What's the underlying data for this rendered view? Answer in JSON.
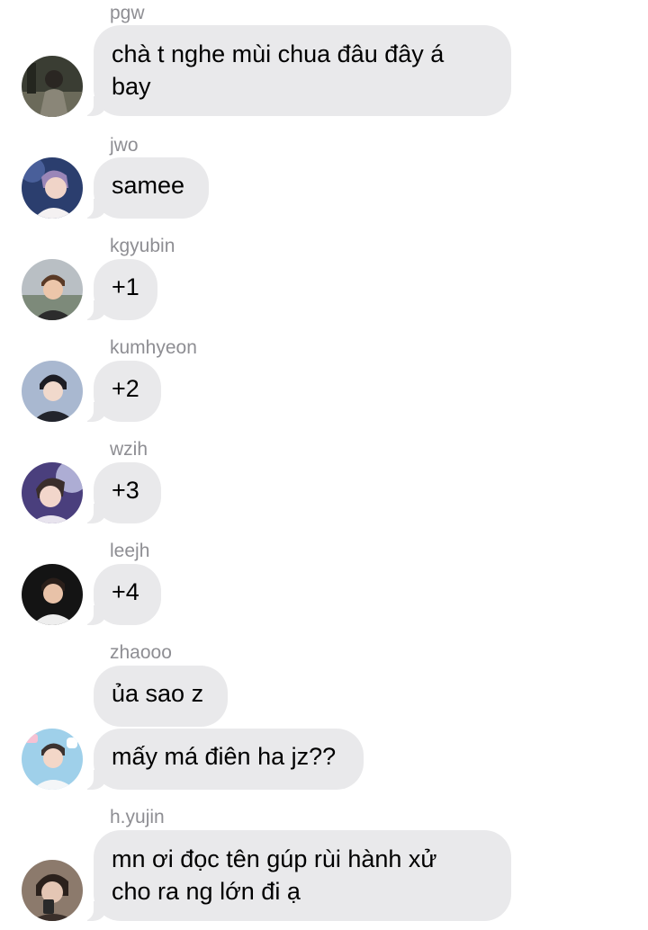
{
  "messages": [
    {
      "sender": "pgw",
      "lines": [
        "chà t nghe mùi chua đâu đây á",
        "bay"
      ],
      "avatar": "profile-photo-pgw"
    },
    {
      "sender": "jwo",
      "lines": [
        "samee"
      ],
      "avatar": "profile-photo-jwo"
    },
    {
      "sender": "kgyubin",
      "lines": [
        "+1"
      ],
      "avatar": "profile-photo-kgyubin"
    },
    {
      "sender": "kumhyeon",
      "lines": [
        "+2"
      ],
      "avatar": "profile-photo-kumhyeon"
    },
    {
      "sender": "wzih",
      "lines": [
        "+3"
      ],
      "avatar": "profile-photo-wzih"
    },
    {
      "sender": "leejh",
      "lines": [
        "+4"
      ],
      "avatar": "profile-photo-leejh"
    },
    {
      "sender": "zhaooo",
      "lines": [
        "ủa sao z"
      ],
      "avatar": null
    },
    {
      "sender": "",
      "lines": [
        "mấy má điên ha jz??"
      ],
      "avatar": "profile-photo-zhaooo"
    },
    {
      "sender": "h.yujin",
      "lines": [
        "mn ơi đọc tên gúp rùi hành xử",
        "cho ra ng lớn đi ạ"
      ],
      "avatar": "profile-photo-hyujin"
    }
  ],
  "colors": {
    "bubble": "#e9e9eb",
    "sender_label": "#8e8e93",
    "text": "#000000",
    "background": "#ffffff"
  }
}
